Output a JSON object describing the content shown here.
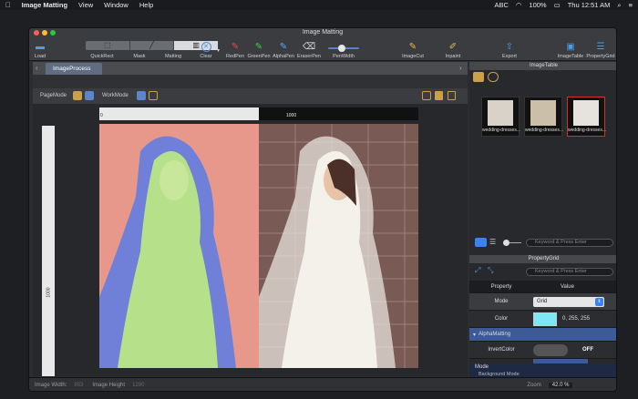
{
  "menubar": {
    "apple": "",
    "app": "Image Matting",
    "items": [
      "View",
      "Window",
      "Help"
    ],
    "status": {
      "abc": "ABC",
      "battery": "100%",
      "clock": "Thu 12:51 AM"
    }
  },
  "window": {
    "title": "Image Matting"
  },
  "toolbar": {
    "load": "Load",
    "quickrect": "QuickRect",
    "mask": "Mask",
    "matting": "Matting",
    "clear": "Clear",
    "redpen": "RedPen",
    "greenpen": "GreenPen",
    "alphapen": "AlphaPen",
    "eraserpen": "EraserPen",
    "penwidth": "PenWidth",
    "imagecut": "ImageCut",
    "inpaint": "Inpaint",
    "export": "Export",
    "imagetable": "ImageTable",
    "propertygrid": "PropertyGrid",
    "penwidth_level": 0.45
  },
  "tab": {
    "label": "ImageProcess"
  },
  "modes": {
    "page": "PageMode",
    "work": "WorkMode"
  },
  "ruler": {
    "h_start": "0",
    "h_mid": "1000",
    "v_mark": "1000"
  },
  "statusbar": {
    "width_label": "Image Width:",
    "width_value": "853",
    "height_label": "Image Height",
    "height_value": "1280",
    "zoom_label": "Zoom",
    "zoom_value": "42.0 %"
  },
  "imagetable": {
    "title": "ImageTable",
    "thumbs": [
      "wedding-dresses...",
      "wedding-dresses...",
      "wedding-dresses..."
    ],
    "search_placeholder": "Keyword & Press Enter"
  },
  "propertygrid": {
    "title": "PropertyGrid",
    "search_placeholder": "Keyword & Press Enter",
    "col_property": "Property",
    "col_value": "Value",
    "mode_label": "Mode",
    "mode_value": "Grid",
    "color_label": "Color",
    "color_value": "0, 255, 255",
    "color_swatch": "#7fe6f5",
    "section": "AlphaMatting",
    "invert_label": "InvertColor",
    "invert_value": "OFF",
    "desc_title": "Mode",
    "desc_text": "Background Mode"
  },
  "colors": {
    "accent": "#3b82f6",
    "thumb_selected": "#d32f2f"
  }
}
